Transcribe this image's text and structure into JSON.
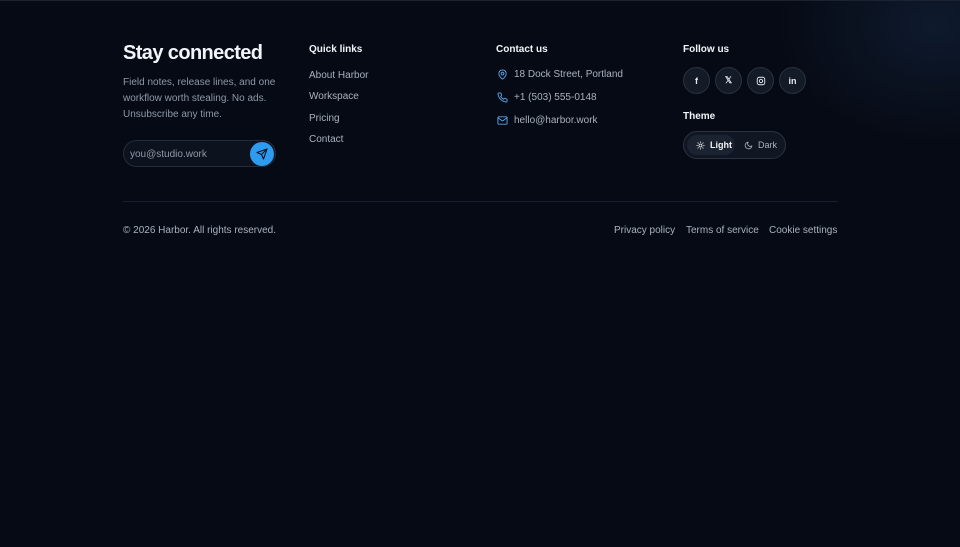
{
  "newsletter": {
    "title": "Stay connected",
    "description": "Field notes, release lines, and one workflow worth stealing. No ads. Unsubscribe any time.",
    "email_placeholder": "you@studio.work",
    "submit_icon": "send-icon"
  },
  "quick_links": {
    "heading": "Quick links",
    "items": [
      "About Harbor",
      "Workspace",
      "Pricing",
      "Contact"
    ]
  },
  "contact": {
    "heading": "Contact us",
    "address": "18 Dock Street, Portland",
    "phone": "+1 (503) 555-0148",
    "email": "hello@harbor.work"
  },
  "follow": {
    "heading": "Follow us",
    "socials": [
      {
        "icon": "facebook-icon",
        "glyph": "f"
      },
      {
        "icon": "x-icon",
        "glyph": "𝕏"
      },
      {
        "icon": "instagram-icon",
        "glyph": ""
      },
      {
        "icon": "linkedin-icon",
        "glyph": "in"
      }
    ]
  },
  "theme": {
    "heading": "Theme",
    "options": [
      "Light",
      "Dark"
    ],
    "selected": "Light"
  },
  "bottom": {
    "copyright": "© 2026 Harbor. All rights reserved.",
    "legal_links": [
      "Privacy policy",
      "Terms of service",
      "Cookie settings"
    ]
  },
  "colors": {
    "background": "#060a14",
    "accent": "#2d9cf0",
    "icon_accent": "#5aa8ec"
  }
}
